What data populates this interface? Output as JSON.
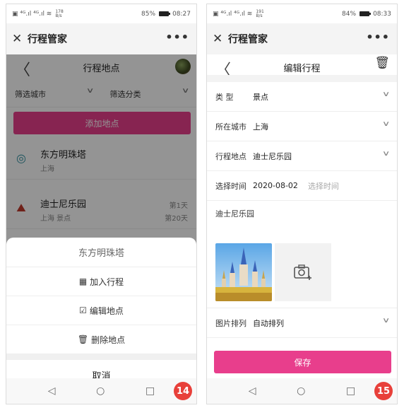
{
  "left_phone": {
    "status": {
      "carrier_icons": "▣ ⁴ᴳ.ıl ⁴ᴳ.ıl ≋",
      "speed": "178 B/s",
      "battery_text": "85%",
      "time": "08:27"
    },
    "app_title": "行程管家",
    "page_title": "行程地点",
    "filters": {
      "city": "筛选城市",
      "category": "筛选分类"
    },
    "add_button": "添加地点",
    "places": [
      {
        "name": "东方明珠塔",
        "subtitle": "上海",
        "day1": "",
        "day2": ""
      },
      {
        "name": "迪士尼乐园",
        "subtitle": "上海 景点",
        "day1": "第1天",
        "day2": "第20天"
      }
    ],
    "sheet": {
      "title": "东方明珠塔",
      "items": [
        {
          "icon": "▦",
          "label": "加入行程"
        },
        {
          "icon": "☑",
          "label": "编辑地点"
        },
        {
          "icon": "🗑",
          "label": "删除地点"
        }
      ],
      "cancel": "取消"
    },
    "badge": "14"
  },
  "right_phone": {
    "status": {
      "carrier_icons": "▣ ⁴ᴳ.ıl ⁴ᴳ.ıl ≋",
      "speed": "191 B/s",
      "battery_text": "84%",
      "time": "08:33"
    },
    "app_title": "行程管家",
    "page_title": "编辑行程",
    "form": {
      "type_label": "类    型",
      "type_value": "景点",
      "city_label": "所在城市",
      "city_value": "上海",
      "place_label": "行程地点",
      "place_value": "迪士尼乐园",
      "time_label": "选择时间",
      "time_value": "2020-08-02",
      "time_placeholder": "选择时间",
      "note": "迪士尼乐园",
      "sort_label": "图片排列",
      "sort_value": "自动排列"
    },
    "save_button": "保存",
    "badge": "15"
  },
  "common": {
    "close": "✕",
    "more": "•••",
    "back": "〈",
    "nav_back": "◁",
    "nav_home": "○",
    "nav_recent": "□"
  }
}
